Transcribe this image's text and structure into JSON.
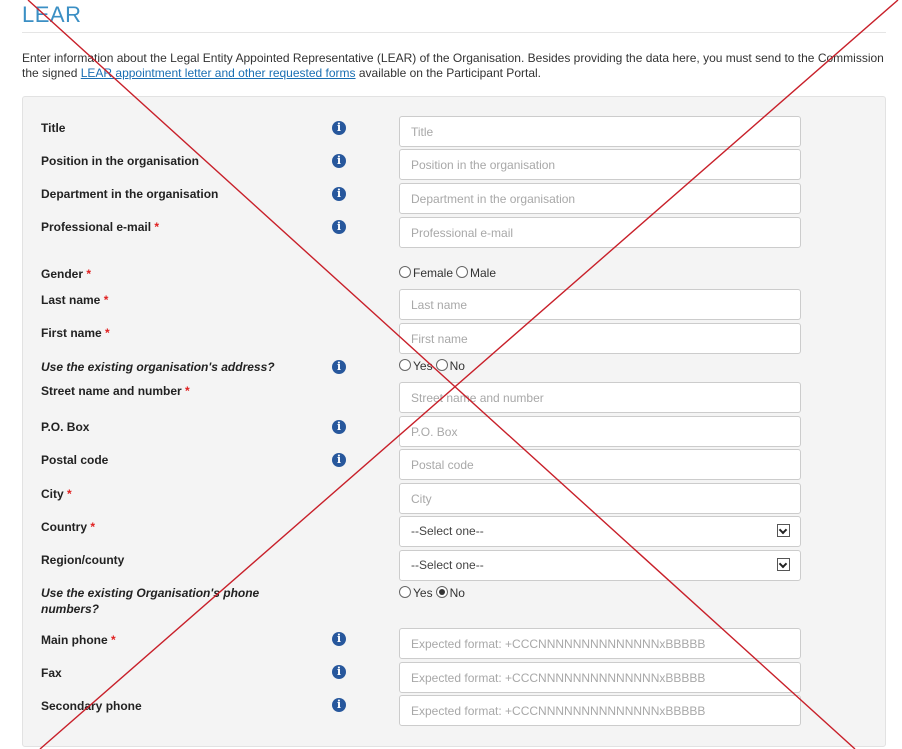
{
  "heading": "LEAR",
  "intro": {
    "before": "Enter information about the Legal Entity Appointed Representative (LEAR) of the Organisation. Besides providing the data here, you must send to the Commission the signed ",
    "link": "LEAR appointment letter and other requested forms",
    "after": " available on the Participant Portal."
  },
  "required_mark": "*",
  "info_glyph": "i",
  "fields": {
    "title": {
      "label": "Title",
      "placeholder": "Title"
    },
    "position": {
      "label": "Position in the organisation",
      "placeholder": "Position in the organisation"
    },
    "department": {
      "label": "Department in the organisation",
      "placeholder": "Department in the organisation"
    },
    "email": {
      "label": "Professional e-mail",
      "placeholder": "Professional e-mail"
    },
    "gender": {
      "label": "Gender",
      "options": [
        "Female",
        "Male"
      ]
    },
    "last_name": {
      "label": "Last name",
      "placeholder": "Last name"
    },
    "first_name": {
      "label": "First name",
      "placeholder": "First name"
    },
    "use_address": {
      "label": "Use the existing organisation's address?",
      "options": [
        "Yes",
        "No"
      ]
    },
    "street": {
      "label": "Street name and number",
      "placeholder": "Street name and number"
    },
    "po_box": {
      "label": "P.O. Box",
      "placeholder": "P.O. Box"
    },
    "postal_code": {
      "label": "Postal code",
      "placeholder": "Postal code"
    },
    "city": {
      "label": "City",
      "placeholder": "City"
    },
    "country": {
      "label": "Country",
      "value": "--Select one--"
    },
    "region": {
      "label": "Region/county",
      "value": "--Select one--"
    },
    "use_phones": {
      "label": "Use the existing Organisation's phone numbers?",
      "options": [
        "Yes",
        "No"
      ],
      "selected": "No"
    },
    "main_phone": {
      "label": "Main phone",
      "placeholder": "Expected format: +CCCNNNNNNNNNNNNNNxBBBBB"
    },
    "fax": {
      "label": "Fax",
      "placeholder": "Expected format: +CCCNNNNNNNNNNNNNNxBBBBB"
    },
    "secondary_phone": {
      "label": "Secondary phone",
      "placeholder": "Expected format: +CCCNNNNNNNNNNNNNNxBBBBB"
    }
  },
  "colors": {
    "heading": "#3b8fc4",
    "link": "#1a6fb3",
    "required": "#e02020",
    "info_icon": "#27579c",
    "cross_lines": "#c8202a"
  }
}
